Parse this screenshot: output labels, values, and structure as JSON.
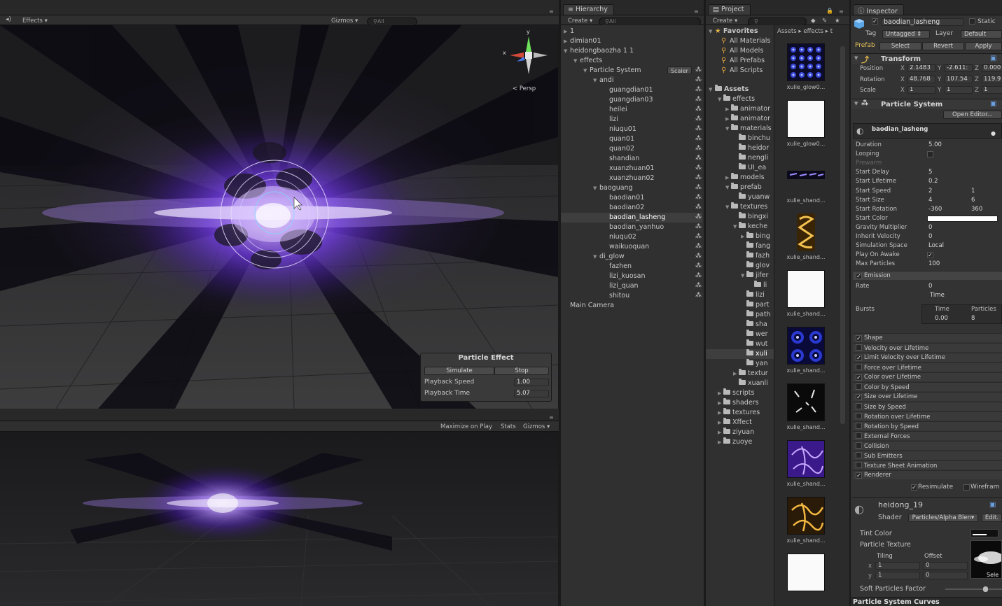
{
  "scene": {
    "menu_icon": "speaker-icon",
    "effects_label": "Effects",
    "gizmos_label": "Gizmos",
    "search_placeholder": "All",
    "persp_label": "Persp",
    "axis_y": "y",
    "axis_x": "x"
  },
  "particle_effect_panel": {
    "title": "Particle Effect",
    "simulate_label": "Simulate",
    "stop_label": "Stop",
    "playback_speed_label": "Playback Speed",
    "playback_speed_value": "1.00",
    "playback_time_label": "Playback Time",
    "playback_time_value": "5.07"
  },
  "game": {
    "maximize_label": "Maximize on Play",
    "stats_label": "Stats",
    "gizmos_label": "Gizmos"
  },
  "hierarchy": {
    "tab_label": "Hierarchy",
    "create_label": "Create",
    "search_placeholder": "All",
    "scaler_label": "Scaler",
    "rows": [
      {
        "label": "1",
        "indent": 0,
        "arrow": "▶"
      },
      {
        "label": "dimian01",
        "indent": 0,
        "arrow": "▶"
      },
      {
        "label": "heidongbaozha 1 1",
        "indent": 0,
        "arrow": "▼"
      },
      {
        "label": "effects",
        "indent": 1,
        "arrow": "▼"
      },
      {
        "label": "Particle System",
        "indent": 2,
        "arrow": "▼",
        "scaler": true
      },
      {
        "label": "andi",
        "indent": 3,
        "arrow": "▼",
        "icon": true
      },
      {
        "label": "guangdian01",
        "indent": 4,
        "arrow": "",
        "icon": true
      },
      {
        "label": "guangdian03",
        "indent": 4,
        "arrow": "",
        "icon": true
      },
      {
        "label": "heilei",
        "indent": 4,
        "arrow": "",
        "icon": true
      },
      {
        "label": "lizi",
        "indent": 4,
        "arrow": "",
        "icon": true
      },
      {
        "label": "niuqu01",
        "indent": 4,
        "arrow": "",
        "icon": true
      },
      {
        "label": "quan01",
        "indent": 4,
        "arrow": "",
        "icon": true
      },
      {
        "label": "quan02",
        "indent": 4,
        "arrow": "",
        "icon": true
      },
      {
        "label": "shandian",
        "indent": 4,
        "arrow": "",
        "icon": true
      },
      {
        "label": "xuanzhuan01",
        "indent": 4,
        "arrow": "",
        "icon": true
      },
      {
        "label": "xuanzhuan02",
        "indent": 4,
        "arrow": "",
        "icon": true
      },
      {
        "label": "baoguang",
        "indent": 3,
        "arrow": "▼",
        "icon": true
      },
      {
        "label": "baodian01",
        "indent": 4,
        "arrow": "",
        "icon": true
      },
      {
        "label": "baodian02",
        "indent": 4,
        "arrow": "",
        "icon": true
      },
      {
        "label": "baodian_lasheng",
        "indent": 4,
        "arrow": "",
        "icon": true,
        "selected": true
      },
      {
        "label": "baodian_yanhuo",
        "indent": 4,
        "arrow": "",
        "icon": true
      },
      {
        "label": "niuqu02",
        "indent": 4,
        "arrow": "",
        "icon": true
      },
      {
        "label": "waikuoquan",
        "indent": 4,
        "arrow": "",
        "icon": true
      },
      {
        "label": "di_glow",
        "indent": 3,
        "arrow": "▼",
        "icon": true
      },
      {
        "label": "fazhen",
        "indent": 4,
        "arrow": "",
        "icon": true
      },
      {
        "label": "lizi_kuosan",
        "indent": 4,
        "arrow": "",
        "icon": true
      },
      {
        "label": "lizi_quan",
        "indent": 4,
        "arrow": "",
        "icon": true
      },
      {
        "label": "shitou",
        "indent": 4,
        "arrow": "",
        "icon": true
      },
      {
        "label": "Main Camera",
        "indent": 0,
        "arrow": ""
      }
    ]
  },
  "project": {
    "tab_label": "Project",
    "create_label": "Create",
    "favorites_label": "Favorites",
    "favorites": [
      "All Materials",
      "All Models",
      "All Prefabs",
      "All Scripts"
    ],
    "assets_label": "Assets",
    "breadcrumb": [
      "Assets",
      "effects"
    ],
    "tree": [
      {
        "label": "effects",
        "indent": 1,
        "arrow": "▼"
      },
      {
        "label": "animator",
        "indent": 2,
        "arrow": "▶"
      },
      {
        "label": "animator",
        "indent": 2,
        "arrow": "▶"
      },
      {
        "label": "materials",
        "indent": 2,
        "arrow": "▼"
      },
      {
        "label": "binchu",
        "indent": 3,
        "arrow": ""
      },
      {
        "label": "heidor",
        "indent": 3,
        "arrow": ""
      },
      {
        "label": "nengli",
        "indent": 3,
        "arrow": ""
      },
      {
        "label": "UI_ea",
        "indent": 3,
        "arrow": ""
      },
      {
        "label": "models",
        "indent": 2,
        "arrow": "▶"
      },
      {
        "label": "prefab",
        "indent": 2,
        "arrow": "▼"
      },
      {
        "label": "yuanw",
        "indent": 3,
        "arrow": ""
      },
      {
        "label": "textures",
        "indent": 2,
        "arrow": "▼"
      },
      {
        "label": "bingxi",
        "indent": 3,
        "arrow": ""
      },
      {
        "label": "keche",
        "indent": 3,
        "arrow": "▼"
      },
      {
        "label": "bing",
        "indent": 4,
        "arrow": "▶"
      },
      {
        "label": "fang",
        "indent": 4,
        "arrow": ""
      },
      {
        "label": "fazh",
        "indent": 4,
        "arrow": ""
      },
      {
        "label": "glov",
        "indent": 4,
        "arrow": ""
      },
      {
        "label": "jifer",
        "indent": 4,
        "arrow": "▼"
      },
      {
        "label": "li",
        "indent": 5,
        "arrow": ""
      },
      {
        "label": "lizi",
        "indent": 4,
        "arrow": ""
      },
      {
        "label": "part",
        "indent": 4,
        "arrow": ""
      },
      {
        "label": "path",
        "indent": 4,
        "arrow": ""
      },
      {
        "label": "sha",
        "indent": 4,
        "arrow": ""
      },
      {
        "label": "wer",
        "indent": 4,
        "arrow": ""
      },
      {
        "label": "wut",
        "indent": 4,
        "arrow": ""
      },
      {
        "label": "xuli",
        "indent": 4,
        "arrow": "",
        "selected": true
      },
      {
        "label": "yan",
        "indent": 4,
        "arrow": ""
      },
      {
        "label": "textur",
        "indent": 3,
        "arrow": "▶"
      },
      {
        "label": "xuanli",
        "indent": 3,
        "arrow": ""
      },
      {
        "label": "scripts",
        "indent": 1,
        "arrow": "▶"
      },
      {
        "label": "shaders",
        "indent": 1,
        "arrow": "▶"
      },
      {
        "label": "textures",
        "indent": 1,
        "arrow": "▶"
      },
      {
        "label": "Xffect",
        "indent": 1,
        "arrow": "▶"
      },
      {
        "label": "ziyuan",
        "indent": 1,
        "arrow": "▶"
      },
      {
        "label": "zuoye",
        "indent": 1,
        "arrow": "▶"
      }
    ],
    "thumbnails": [
      {
        "label": "xulie_glow0...",
        "style": "dots"
      },
      {
        "label": "xulie_glow0...",
        "style": "white"
      },
      {
        "label": "xulie_shand...",
        "style": "strip"
      },
      {
        "label": "xulie_shand...",
        "style": "gold"
      },
      {
        "label": "xulie_shand...",
        "style": "white"
      },
      {
        "label": "xulie_shand...",
        "style": "rings"
      },
      {
        "label": "xulie_shand...",
        "style": "sparks"
      },
      {
        "label": "xulie_shand...",
        "style": "purple"
      },
      {
        "label": "xulie_shand...",
        "style": "amber"
      },
      {
        "label": "",
        "style": "white"
      }
    ]
  },
  "inspector": {
    "tab_label": "Inspector",
    "object_name": "baodian_lasheng",
    "static_label": "Static",
    "tag_label": "Tag",
    "tag_value": "Untagged",
    "layer_label": "Layer",
    "layer_value": "Default",
    "prefab_label": "Prefab",
    "select_label": "Select",
    "revert_label": "Revert",
    "apply_label": "Apply",
    "transform": {
      "title": "Transform",
      "position_label": "Position",
      "position": {
        "x": "2.1483",
        "y": "-2.611:",
        "z": "0.000"
      },
      "rotation_label": "Rotation",
      "rotation": {
        "x": "48.768",
        "y": "107.54",
        "z": "119.9"
      },
      "scale_label": "Scale",
      "scale": {
        "x": "1",
        "y": "1",
        "z": "1"
      }
    },
    "particle_system": {
      "title": "Particle System",
      "open_editor_label": "Open Editor...",
      "subsystem_name": "baodian_lasheng",
      "fields": [
        {
          "label": "Duration",
          "v1": "5.00",
          "v2": ""
        },
        {
          "label": "Looping",
          "v1": "",
          "v2": "",
          "checkbox": true,
          "checked": false
        },
        {
          "label": "Prewarm",
          "v1": "",
          "v2": "",
          "dim": true
        },
        {
          "label": "Start Delay",
          "v1": "5",
          "v2": ""
        },
        {
          "label": "Start Lifetime",
          "v1": "0.2",
          "v2": ""
        },
        {
          "label": "Start Speed",
          "v1": "2",
          "v2": "1"
        },
        {
          "label": "Start Size",
          "v1": "4",
          "v2": "6"
        },
        {
          "label": "Start Rotation",
          "v1": "-360",
          "v2": "360"
        },
        {
          "label": "Start Color",
          "v1": "",
          "v2": "",
          "color": "#ffffff"
        },
        {
          "label": "Gravity Multiplier",
          "v1": "0",
          "v2": ""
        },
        {
          "label": "Inherit Velocity",
          "v1": "0",
          "v2": ""
        },
        {
          "label": "Simulation Space",
          "v1": "Local",
          "v2": ""
        },
        {
          "label": "Play On Awake",
          "v1": "",
          "v2": "",
          "checkbox": true,
          "checked": true
        },
        {
          "label": "Max Particles",
          "v1": "100",
          "v2": ""
        }
      ],
      "emission": {
        "title": "Emission",
        "rate_label": "Rate",
        "rate_value": "0",
        "rate_mode": "Time",
        "bursts_label": "Bursts",
        "bursts_time_header": "Time",
        "bursts_particles_header": "Particles",
        "burst_time": "0.00",
        "burst_particles": "8"
      },
      "modules": [
        {
          "label": "Shape",
          "checked": true
        },
        {
          "label": "Velocity over Lifetime",
          "checked": false
        },
        {
          "label": "Limit Velocity over Lifetime",
          "checked": true
        },
        {
          "label": "Force over Lifetime",
          "checked": false
        },
        {
          "label": "Color over Lifetime",
          "checked": true
        },
        {
          "label": "Color by Speed",
          "checked": false
        },
        {
          "label": "Size over Lifetime",
          "checked": true
        },
        {
          "label": "Size by Speed",
          "checked": false
        },
        {
          "label": "Rotation over Lifetime",
          "checked": false
        },
        {
          "label": "Rotation by Speed",
          "checked": false
        },
        {
          "label": "External Forces",
          "checked": false
        },
        {
          "label": "Collision",
          "checked": false
        },
        {
          "label": "Sub Emitters",
          "checked": false
        },
        {
          "label": "Texture Sheet Animation",
          "checked": false
        },
        {
          "label": "Renderer",
          "checked": true
        }
      ],
      "resimulate_label": "Resimulate",
      "wireframe_label": "Wirefram"
    },
    "material": {
      "name": "heidong_19",
      "shader_label": "Shader",
      "shader_value": "Particles/Alpha Blen",
      "edit_label": "Edit.",
      "tint_color_label": "Tint Color",
      "particle_texture_label": "Particle Texture",
      "tiling_label": "Tiling",
      "offset_label": "Offset",
      "x_label": "x",
      "y_label": "y",
      "tiling_x": "1",
      "tiling_y": "1",
      "offset_x": "0",
      "offset_y": "0",
      "select_label": "Sele",
      "soft_particles_label": "Soft Particles Factor"
    },
    "curves_label": "Particle System Curves"
  }
}
